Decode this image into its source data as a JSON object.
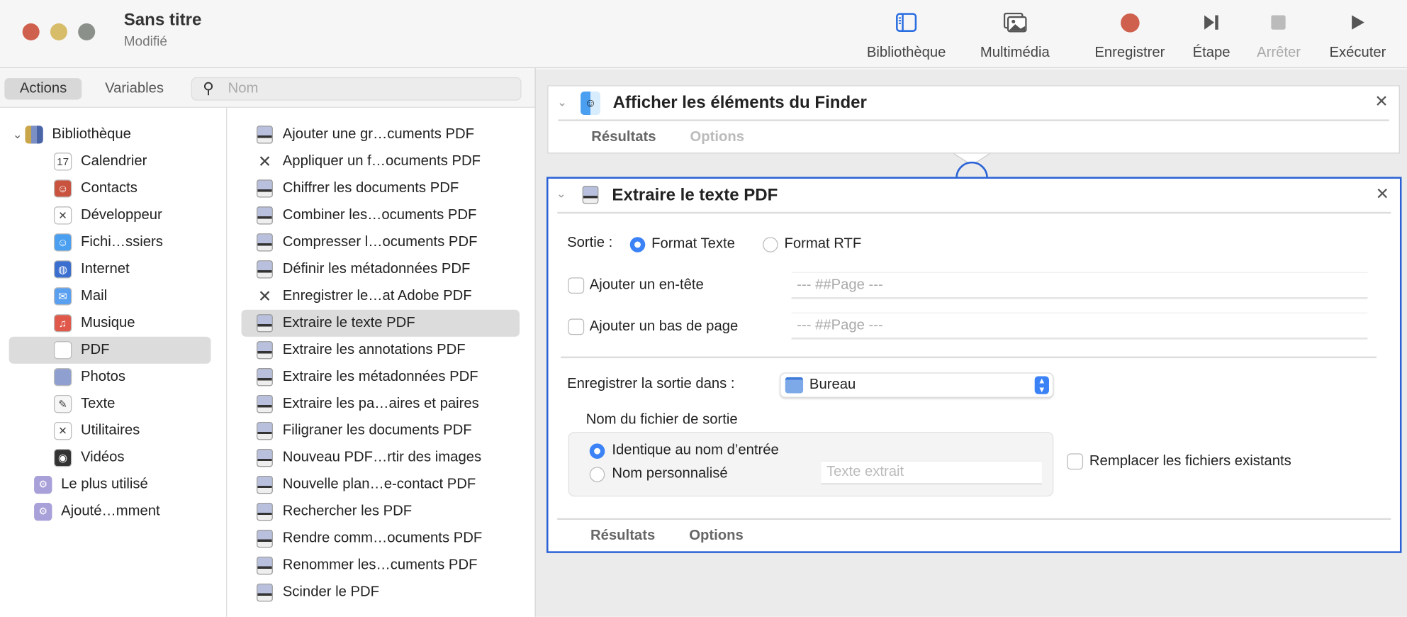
{
  "window": {
    "title": "Sans titre",
    "subtitle": "Modifié",
    "lights": [
      "#d0604e",
      "#d7bd6a",
      "#8b908a"
    ]
  },
  "toolbar": [
    {
      "label": "Bibliothèque",
      "icon": "sidebar-icon"
    },
    {
      "label": "Multimédia",
      "icon": "photos-icon"
    },
    {
      "label": "Enregistrer",
      "icon": "record-icon"
    },
    {
      "label": "Étape",
      "icon": "step-icon"
    },
    {
      "label": "Arrêter",
      "icon": "stop-icon",
      "disabled": true
    },
    {
      "label": "Exécuter",
      "icon": "play-icon"
    }
  ],
  "left": {
    "tabs": [
      "Actions",
      "Variables"
    ],
    "search_placeholder": "Nom",
    "library_root": "Bibliothèque",
    "categories": [
      "Calendrier",
      "Contacts",
      "Développeur",
      "Fichi…ssiers",
      "Internet",
      "Mail",
      "Musique",
      "PDF",
      "Photos",
      "Texte",
      "Utilitaires",
      "Vidéos"
    ],
    "selected_category": "PDF",
    "extras": [
      "Le plus utilisé",
      "Ajouté…mment"
    ],
    "actions": [
      "Ajouter une gr…cuments PDF",
      "Appliquer un f…ocuments PDF",
      "Chiffrer les documents PDF",
      "Combiner les…ocuments PDF",
      "Compresser l…ocuments PDF",
      "Définir les métadonnées PDF",
      "Enregistrer le…at Adobe PDF",
      "Extraire le texte PDF",
      "Extraire les annotations PDF",
      "Extraire les métadonnées PDF",
      "Extraire les pa…aires et paires",
      "Filigraner les documents PDF",
      "Nouveau PDF…rtir des images",
      "Nouvelle plan…e-contact PDF",
      "Rechercher les PDF",
      "Rendre comm…ocuments PDF",
      "Renommer les…cuments PDF",
      "Scinder le PDF"
    ],
    "selected_action": "Extraire le texte PDF"
  },
  "workflow": {
    "card1": {
      "title": "Afficher les éléments du Finder",
      "tabs": [
        "Résultats",
        "Options"
      ]
    },
    "card2": {
      "title": "Extraire le texte PDF",
      "output_label": "Sortie :",
      "format_text": "Format Texte",
      "format_rtf": "Format RTF",
      "selected_format": "Format Texte",
      "header_label": "Ajouter un en-tête",
      "header_placeholder": "--- ##Page ---",
      "footer_label": "Ajouter un bas de page",
      "footer_placeholder": "--- ##Page ---",
      "save_label": "Enregistrer la sortie dans :",
      "save_value": "Bureau",
      "filename_label": "Nom du fichier de sortie",
      "same_name": "Identique au nom d’entrée",
      "custom_name": "Nom personnalisé",
      "custom_placeholder": "Texte extrait",
      "replace_label": "Remplacer les fichiers existants",
      "tabs": [
        "Résultats",
        "Options"
      ]
    },
    "accent": "#2a62d6"
  }
}
